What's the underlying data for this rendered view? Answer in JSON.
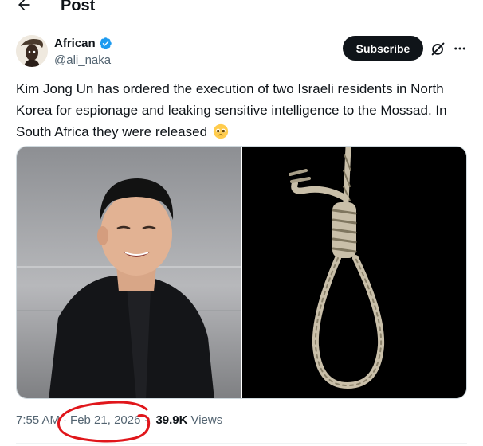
{
  "header": {
    "title": "Post",
    "back_icon": "arrow-left-icon"
  },
  "author": {
    "display_name": "African",
    "handle": "@ali_naka",
    "verified_icon": "verified-badge-icon",
    "verified_color": "#1d9bf0"
  },
  "actions": {
    "subscribe_label": "Subscribe",
    "grok_icon": "grok-icon",
    "more_icon": "more-horizontal-icon"
  },
  "tweet": {
    "text": "Kim Jong Un has ordered the execution of two Israeli residents in North Korea for espionage and leaking sensitive intelligence to the Mossad. In South Africa they were released",
    "emoji": "pleading-face-emoji"
  },
  "media": [
    {
      "name": "photo-kim-jong-un",
      "alt_icon": "portrait-photo"
    },
    {
      "name": "photo-noose",
      "alt_icon": "noose-photo"
    }
  ],
  "meta": {
    "time": "7:55 AM",
    "date": "Feb 21, 2026",
    "views_count": "39.9K",
    "views_label": "Views",
    "annotation_color": "#e0161b"
  },
  "colors": {
    "text": "#0f1419",
    "secondary": "#536471",
    "button_bg": "#0f1419"
  }
}
